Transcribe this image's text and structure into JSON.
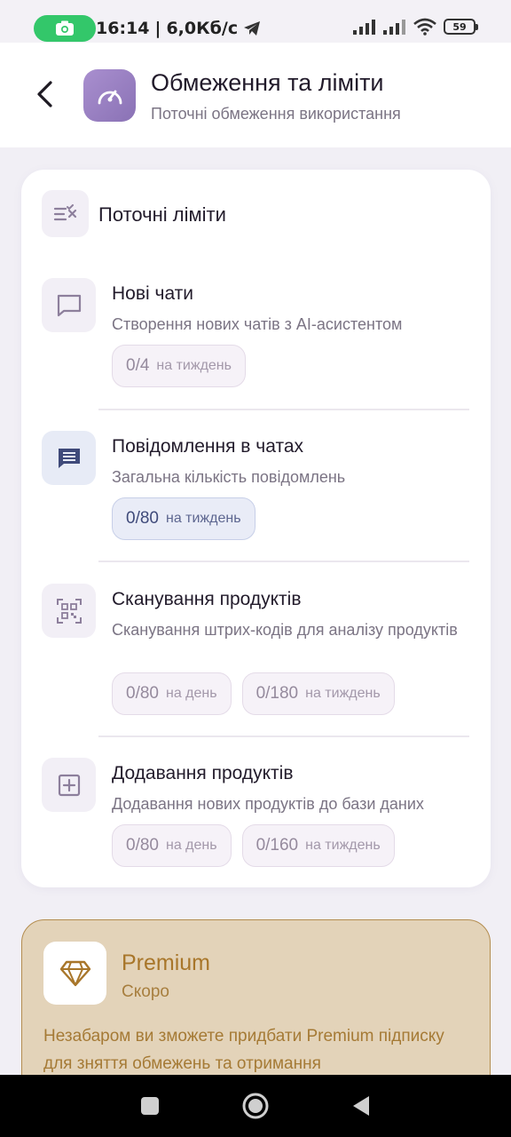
{
  "status_bar": {
    "time": "16:14",
    "speed": "6,0Кб/с",
    "battery": "59"
  },
  "header": {
    "title": "Обмеження та ліміти",
    "subtitle": "Поточні обмеження використання"
  },
  "limits": {
    "title": "Поточні ліміти",
    "items": [
      {
        "title": "Нові чати",
        "description": "Створення нових чатів з AI-асистентом",
        "chips": [
          {
            "value": "0/4",
            "period": "на тиждень"
          }
        ]
      },
      {
        "title": "Повідомлення в чатах",
        "description": "Загальна кількість повідомлень",
        "chips": [
          {
            "value": "0/80",
            "period": "на тиждень"
          }
        ]
      },
      {
        "title": "Сканування продуктів",
        "description": "Сканування штрих-кодів для аналізу продуктів",
        "chips": [
          {
            "value": "0/80",
            "period": "на день"
          },
          {
            "value": "0/180",
            "period": "на тиждень"
          }
        ]
      },
      {
        "title": "Додавання продуктів",
        "description": "Додавання нових продуктів до бази даних",
        "chips": [
          {
            "value": "0/80",
            "period": "на день"
          },
          {
            "value": "0/160",
            "period": "на тиждень"
          }
        ]
      }
    ]
  },
  "premium": {
    "title": "Premium",
    "subtitle": "Скоро",
    "text": "Незабаром ви зможете придбати Premium підписку для зняття обмежень та отримання"
  },
  "colors": {
    "accent": "#8a72b5",
    "premium_gold": "#a8762a",
    "premium_bg": "#e3d3b9",
    "chat_blue": "#3f4a7a"
  },
  "icons": {
    "header": "speedometer-icon",
    "limits": "checklist-icon",
    "chats": "chat-bubble-icon",
    "messages": "message-lines-icon",
    "scan": "qr-scan-icon",
    "add": "add-box-icon",
    "premium": "diamond-icon"
  }
}
